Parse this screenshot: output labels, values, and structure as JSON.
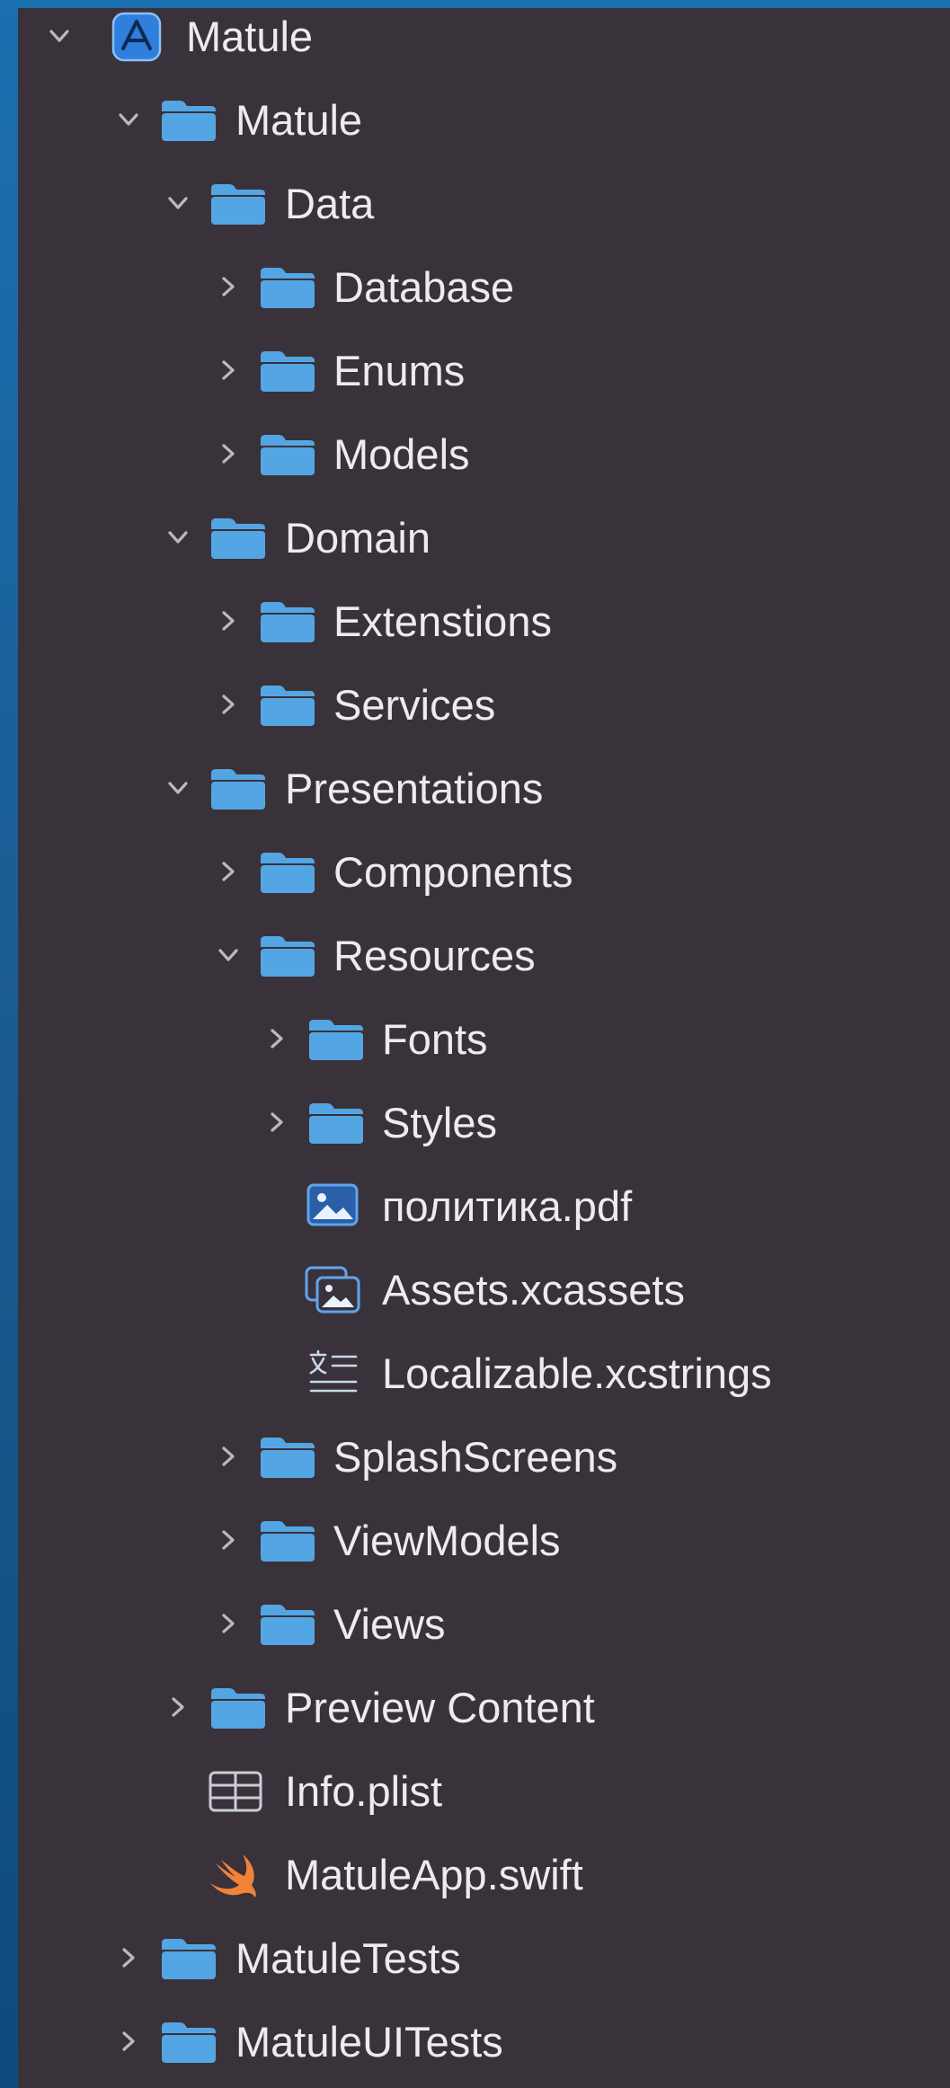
{
  "navigator": {
    "items": [
      {
        "label": "Matule",
        "type": "project",
        "expanded": true,
        "icon": "xcode-project-icon"
      },
      {
        "label": "Matule",
        "type": "folder",
        "expanded": true,
        "icon": "folder-icon"
      },
      {
        "label": "Data",
        "type": "folder",
        "expanded": true,
        "icon": "folder-icon"
      },
      {
        "label": "Database",
        "type": "folder",
        "expanded": false,
        "icon": "folder-icon"
      },
      {
        "label": "Enums",
        "type": "folder",
        "expanded": false,
        "icon": "folder-icon"
      },
      {
        "label": "Models",
        "type": "folder",
        "expanded": false,
        "icon": "folder-icon"
      },
      {
        "label": "Domain",
        "type": "folder",
        "expanded": true,
        "icon": "folder-icon"
      },
      {
        "label": "Extenstions",
        "type": "folder",
        "expanded": false,
        "icon": "folder-icon"
      },
      {
        "label": "Services",
        "type": "folder",
        "expanded": false,
        "icon": "folder-icon"
      },
      {
        "label": "Presentations",
        "type": "folder",
        "expanded": true,
        "icon": "folder-icon"
      },
      {
        "label": "Components",
        "type": "folder",
        "expanded": false,
        "icon": "folder-icon"
      },
      {
        "label": "Resources",
        "type": "folder",
        "expanded": true,
        "icon": "folder-icon"
      },
      {
        "label": "Fonts",
        "type": "folder",
        "expanded": false,
        "icon": "folder-icon"
      },
      {
        "label": "Styles",
        "type": "folder",
        "expanded": false,
        "icon": "folder-icon"
      },
      {
        "label": "политика.pdf",
        "type": "file",
        "icon": "image-file-icon"
      },
      {
        "label": "Assets.xcassets",
        "type": "file",
        "icon": "asset-catalog-icon"
      },
      {
        "label": "Localizable.xcstrings",
        "type": "file",
        "icon": "string-catalog-icon"
      },
      {
        "label": "SplashScreens",
        "type": "folder",
        "expanded": false,
        "icon": "folder-icon"
      },
      {
        "label": "ViewModels",
        "type": "folder",
        "expanded": false,
        "icon": "folder-icon"
      },
      {
        "label": "Views",
        "type": "folder",
        "expanded": false,
        "icon": "folder-icon"
      },
      {
        "label": "Preview Content",
        "type": "folder",
        "expanded": false,
        "icon": "folder-icon"
      },
      {
        "label": "Info.plist",
        "type": "file",
        "icon": "plist-icon"
      },
      {
        "label": "MatuleApp.swift",
        "type": "file",
        "icon": "swift-icon"
      },
      {
        "label": "MatuleTests",
        "type": "folder",
        "expanded": false,
        "icon": "folder-icon"
      },
      {
        "label": "MatuleUITests",
        "type": "folder",
        "expanded": false,
        "icon": "folder-icon"
      }
    ]
  },
  "colors": {
    "panel_background": "#3a323a",
    "folder_blue": "#53a6e3",
    "text": "#ecebee",
    "chevron": "#bdb7bf",
    "swift_orange": "#f0823a",
    "desktop_blue": "#1a6fb0"
  }
}
